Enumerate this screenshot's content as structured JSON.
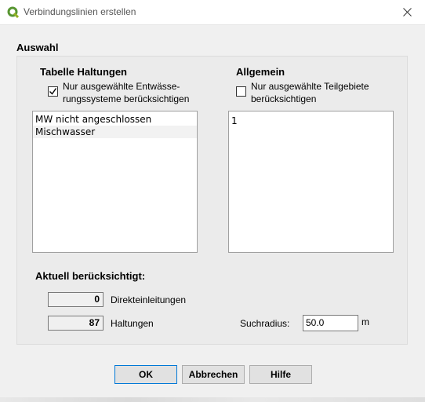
{
  "window": {
    "title": "Verbindungslinien erstellen",
    "close_icon": "close-icon"
  },
  "auswahl": {
    "title": "Auswahl"
  },
  "haltungen": {
    "title": "Tabelle Haltungen",
    "checkbox_line1": "Nur ausgewählte Entwässe-",
    "checkbox_line2": "rungssysteme berücksichtigen",
    "checked": true,
    "items": [
      "MW nicht angeschlossen",
      "Mischwasser"
    ]
  },
  "allgemein": {
    "title": "Allgemein",
    "checkbox_line1": "Nur ausgewählte Teilgebiete",
    "checkbox_line2": "berücksichtigen",
    "checked": false,
    "items": [
      "1"
    ]
  },
  "aktuell": {
    "title": "Aktuell berücksichtigt:",
    "direkt_count": "0",
    "direkt_label": "Direkteinleitungen",
    "haltungen_count": "87",
    "haltungen_label": "Haltungen"
  },
  "suchradius": {
    "label": "Suchradius:",
    "value": "50.0",
    "unit": "m"
  },
  "buttons": {
    "ok": "OK",
    "abbrechen": "Abbrechen",
    "hilfe": "Hilfe"
  }
}
